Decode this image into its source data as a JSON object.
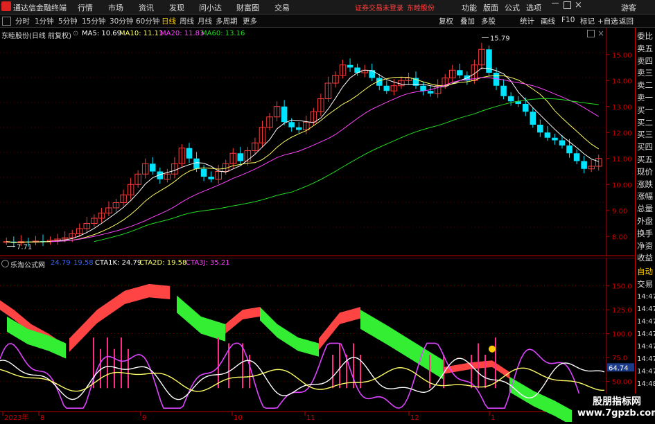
{
  "app": {
    "title": "通达信金融终端"
  },
  "menu": [
    "行情",
    "市场",
    "资讯",
    "发现",
    "问小达",
    "财富圈",
    "交易"
  ],
  "warning": "证券交易未登录",
  "stock_name_title": "东睦股份",
  "right_menu": [
    "功能",
    "版面",
    "公式",
    "选项"
  ],
  "guest": "游客",
  "period_tabs": [
    "分时",
    "1分钟",
    "5分钟",
    "15分钟",
    "30分钟",
    "60分钟",
    "日线",
    "周线",
    "月线",
    "多周期",
    "更多"
  ],
  "active_tab": "日线",
  "toolbar_buttons": [
    "复权",
    "叠加",
    "多股",
    "统计",
    "画线",
    "F10",
    "标记",
    "+自选",
    "返回"
  ],
  "price_header": {
    "stock": "东睦股份(日线 前复权)",
    "ma5": "MA5: 10.69",
    "ma10": "MA10: 11.11",
    "ma20": "MA20: 11.83",
    "ma60": "MA60: 13.16"
  },
  "price_axis": [
    "15.00",
    "14.00",
    "13.00",
    "12.00",
    "11.00",
    "10.00",
    "9.00",
    "8.00"
  ],
  "price_markers": {
    "high": "15.79",
    "low": "7.71"
  },
  "indicator_header": {
    "name": "乐淘公式网",
    "v1": "24.79",
    "v2": "19.58",
    "cta1k": "CTA1K: 24.79",
    "cta2d": "CTA2D: 19.58",
    "cta3j": "CTA3J: 35.21"
  },
  "indicator_axis": [
    "150.0",
    "125.0",
    "100.0",
    "75.0",
    "50.00"
  ],
  "indicator_current": "64.74",
  "date_axis": [
    "2023年",
    "8",
    "9",
    "10",
    "11",
    "12",
    "1"
  ],
  "right_panel": [
    "委比",
    "卖五",
    "卖四",
    "卖三",
    "卖二",
    "卖一",
    "买一",
    "买二",
    "买三",
    "买四",
    "买五",
    "现价",
    "涨跌",
    "涨幅",
    "总量",
    "外盘",
    "换手",
    "净资",
    "收益"
  ],
  "right_panel2": [
    "自动",
    "交易",
    "14:47",
    "14:47",
    "14:47",
    "14:47",
    "14:47",
    "14:47",
    "14:47",
    "14:48",
    "14:48",
    "14:48"
  ],
  "watermark": {
    "line1": "股朋指标网",
    "line2": "www.7gpzb.com"
  },
  "colors": {
    "up": "#ff3c3c",
    "down": "#00e5ff",
    "ma5": "#ffffff",
    "ma10": "#ffff66",
    "ma20": "#ff44ff",
    "ma60": "#22dd22",
    "axis": "#c00000"
  },
  "chart_data": {
    "type": "candlestick",
    "ma_series": [
      "MA5",
      "MA10",
      "MA20",
      "MA60"
    ],
    "closes": [
      7.8,
      7.75,
      7.8,
      7.78,
      7.82,
      7.8,
      7.85,
      7.9,
      7.95,
      8.1,
      8.3,
      8.5,
      8.7,
      8.9,
      9.1,
      9.3,
      9.6,
      10,
      10.4,
      10.8,
      10.5,
      10.2,
      10.4,
      10.8,
      11.4,
      11,
      10.6,
      10.3,
      10.2,
      10.5,
      10.8,
      11.2,
      10.9,
      11.3,
      11.6,
      12.2,
      12.6,
      13,
      12.4,
      12.2,
      12.1,
      12.4,
      12.8,
      13.3,
      13.9,
      14.2,
      14.6,
      14.5,
      14.3,
      14.4,
      14.1,
      13.8,
      13.6,
      13.8,
      14,
      14.1,
      13.8,
      13.6,
      13.5,
      13.8,
      14.1,
      14.4,
      14.2,
      14,
      14.6,
      15.2,
      14.3,
      13.8,
      13.4,
      13.2,
      13.1,
      12.8,
      12.3,
      12,
      11.8,
      11.7,
      11.5,
      11.2,
      10.9,
      10.6,
      10.7,
      11
    ]
  }
}
